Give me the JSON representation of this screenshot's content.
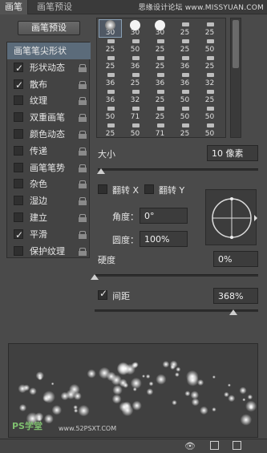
{
  "tabs": [
    "画笔",
    "画笔预设"
  ],
  "watermark": "思缘设计论坛 www.MISSYUAN.COM",
  "preset_button": "画笔预设",
  "options": [
    {
      "label": "画笔笔尖形状",
      "checkbox": false,
      "checked": false,
      "lock": false,
      "selected": true
    },
    {
      "label": "形状动态",
      "checkbox": true,
      "checked": true,
      "lock": true
    },
    {
      "label": "散布",
      "checkbox": true,
      "checked": true,
      "lock": true
    },
    {
      "label": "纹理",
      "checkbox": true,
      "checked": false,
      "lock": true
    },
    {
      "label": "双重画笔",
      "checkbox": true,
      "checked": false,
      "lock": true
    },
    {
      "label": "颜色动态",
      "checkbox": true,
      "checked": false,
      "lock": true
    },
    {
      "label": "传递",
      "checkbox": true,
      "checked": false,
      "lock": true
    },
    {
      "label": "画笔笔势",
      "checkbox": true,
      "checked": false,
      "lock": true
    },
    {
      "label": "杂色",
      "checkbox": true,
      "checked": false,
      "lock": true
    },
    {
      "label": "湿边",
      "checkbox": true,
      "checked": false,
      "lock": true
    },
    {
      "label": "建立",
      "checkbox": true,
      "checked": false,
      "lock": true
    },
    {
      "label": "平滑",
      "checkbox": true,
      "checked": true,
      "lock": true
    },
    {
      "label": "保护纹理",
      "checkbox": true,
      "checked": false,
      "lock": true
    }
  ],
  "brush_sizes": [
    [
      30,
      30,
      30,
      25,
      25
    ],
    [
      25,
      50,
      25,
      25,
      50
    ],
    [
      25,
      36,
      25,
      36,
      25
    ],
    [
      36,
      25,
      36,
      36,
      32
    ],
    [
      36,
      32,
      25,
      50,
      25
    ],
    [
      50,
      71,
      25,
      50,
      50
    ],
    [
      25,
      50,
      71,
      25,
      50
    ]
  ],
  "size_label": "大小",
  "size_value": "10 像素",
  "flip_x": "翻转 X",
  "flip_y": "翻转 Y",
  "angle_label": "角度：",
  "angle_value": "0°",
  "roundness_label": "圆度：",
  "roundness_value": "100%",
  "hardness_label": "硬度",
  "hardness_value": "0%",
  "spacing_label": "间距",
  "spacing_checked": true,
  "spacing_value": "368%",
  "size_slider": 0.02,
  "hardness_slider": 0.0,
  "spacing_slider": 0.85,
  "ps_logo": "PS学堂",
  "footer_url": "www.52PSXT.COM"
}
